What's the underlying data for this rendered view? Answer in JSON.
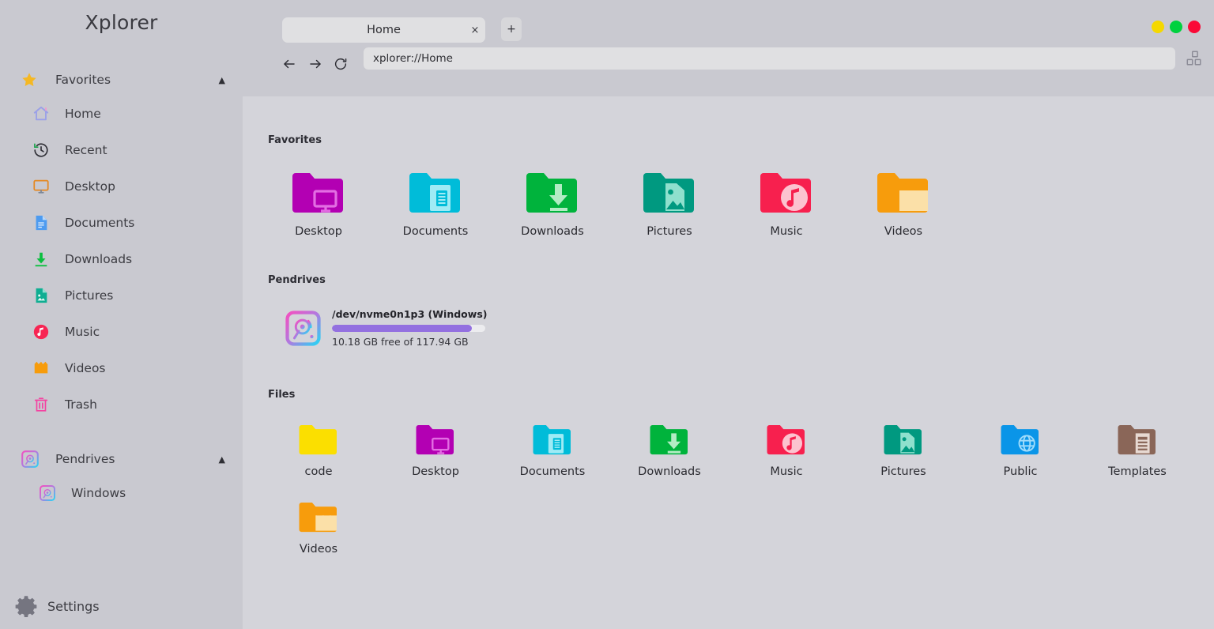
{
  "app": {
    "title": "Xplorer"
  },
  "sidebar": {
    "favorites_group": {
      "label": "Favorites",
      "icon": "star-icon",
      "caret": "▲"
    },
    "favorites_items": [
      {
        "label": "Home",
        "icon": "home-icon"
      },
      {
        "label": "Recent",
        "icon": "history-icon"
      },
      {
        "label": "Desktop",
        "icon": "monitor-icon"
      },
      {
        "label": "Documents",
        "icon": "document-icon"
      },
      {
        "label": "Downloads",
        "icon": "download-icon"
      },
      {
        "label": "Pictures",
        "icon": "image-file-icon"
      },
      {
        "label": "Music",
        "icon": "music-note-icon"
      },
      {
        "label": "Videos",
        "icon": "clapperboard-icon"
      },
      {
        "label": "Trash",
        "icon": "trash-icon"
      }
    ],
    "pendrives_group": {
      "label": "Pendrives",
      "icon": "disk-icon",
      "caret": "▲"
    },
    "pendrives_items": [
      {
        "label": "Windows",
        "icon": "disk-icon"
      }
    ],
    "settings": {
      "label": "Settings",
      "icon": "gear-icon"
    }
  },
  "tabs": {
    "items": [
      {
        "label": "Home",
        "close": "×"
      }
    ],
    "new_tab": "+"
  },
  "window_controls": {
    "minimize_color": "#f5d800",
    "maximize_color": "#00d13f",
    "close_color": "#fa0a37"
  },
  "toolbar": {
    "back": "←",
    "forward": "→",
    "reload": "⟳",
    "view_toggle": "layout-grid-icon"
  },
  "address": {
    "value": "xplorer://Home",
    "placeholder": "xplorer://"
  },
  "main": {
    "favorites": {
      "title": "Favorites",
      "items": [
        {
          "label": "Desktop",
          "icon": "folder-desktop-icon"
        },
        {
          "label": "Documents",
          "icon": "folder-documents-icon"
        },
        {
          "label": "Downloads",
          "icon": "folder-downloads-icon"
        },
        {
          "label": "Pictures",
          "icon": "folder-pictures-icon"
        },
        {
          "label": "Music",
          "icon": "folder-music-icon"
        },
        {
          "label": "Videos",
          "icon": "folder-videos-icon"
        }
      ]
    },
    "pendrives": {
      "title": "Pendrives",
      "drives": [
        {
          "name": "/dev/nvme0n1p3 (Windows)",
          "usage_text": "10.18 GB free of 117.94 GB",
          "used_percent": 91,
          "icon": "disk-icon",
          "bar_color": "#9370e0"
        }
      ]
    },
    "files": {
      "title": "Files",
      "items": [
        {
          "label": "code",
          "icon": "folder-plain-icon"
        },
        {
          "label": "Desktop",
          "icon": "folder-desktop-icon"
        },
        {
          "label": "Documents",
          "icon": "folder-documents-icon"
        },
        {
          "label": "Downloads",
          "icon": "folder-downloads-icon"
        },
        {
          "label": "Music",
          "icon": "folder-music-icon"
        },
        {
          "label": "Pictures",
          "icon": "folder-pictures-icon"
        },
        {
          "label": "Public",
          "icon": "folder-public-icon"
        },
        {
          "label": "Templates",
          "icon": "folder-templates-icon"
        },
        {
          "label": "Videos",
          "icon": "folder-videos-icon"
        }
      ]
    }
  }
}
